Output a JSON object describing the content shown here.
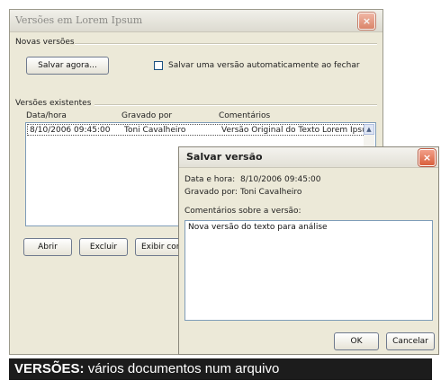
{
  "main_dialog": {
    "title": "Versões em Lorem Ipsum",
    "close": "×",
    "new_versions_label": "Novas versões",
    "save_now_button": "Salvar agora...",
    "auto_save_checkbox_label": "Salvar uma versão automaticamente ao fechar",
    "existing_versions_label": "Versões existentes",
    "columns": [
      "Data/hora",
      "Gravado por",
      "Comentários"
    ],
    "rows": [
      {
        "datetime": "8/10/2006 09:45:00",
        "author": "Toni Cavalheiro",
        "comment": "Versão Original do Texto Lorem Ipsum"
      }
    ],
    "buttons": {
      "open": "Abrir",
      "delete": "Excluir",
      "view_comments": "Exibir comentários"
    }
  },
  "save_dialog": {
    "title": "Salvar versão",
    "close": "×",
    "date_label": "Data e hora:",
    "date_value": "8/10/2006 09:45:00",
    "author_label": "Gravado por:",
    "author_value": "Toni Cavalheiro",
    "comments_label": "Comentários sobre a versão:",
    "comment_text": "Nova versão do texto para análise",
    "ok": "OK",
    "cancel": "Cancelar"
  },
  "caption": {
    "bold": "VERSÕES:",
    "rest": " vários documentos num arquivo"
  }
}
